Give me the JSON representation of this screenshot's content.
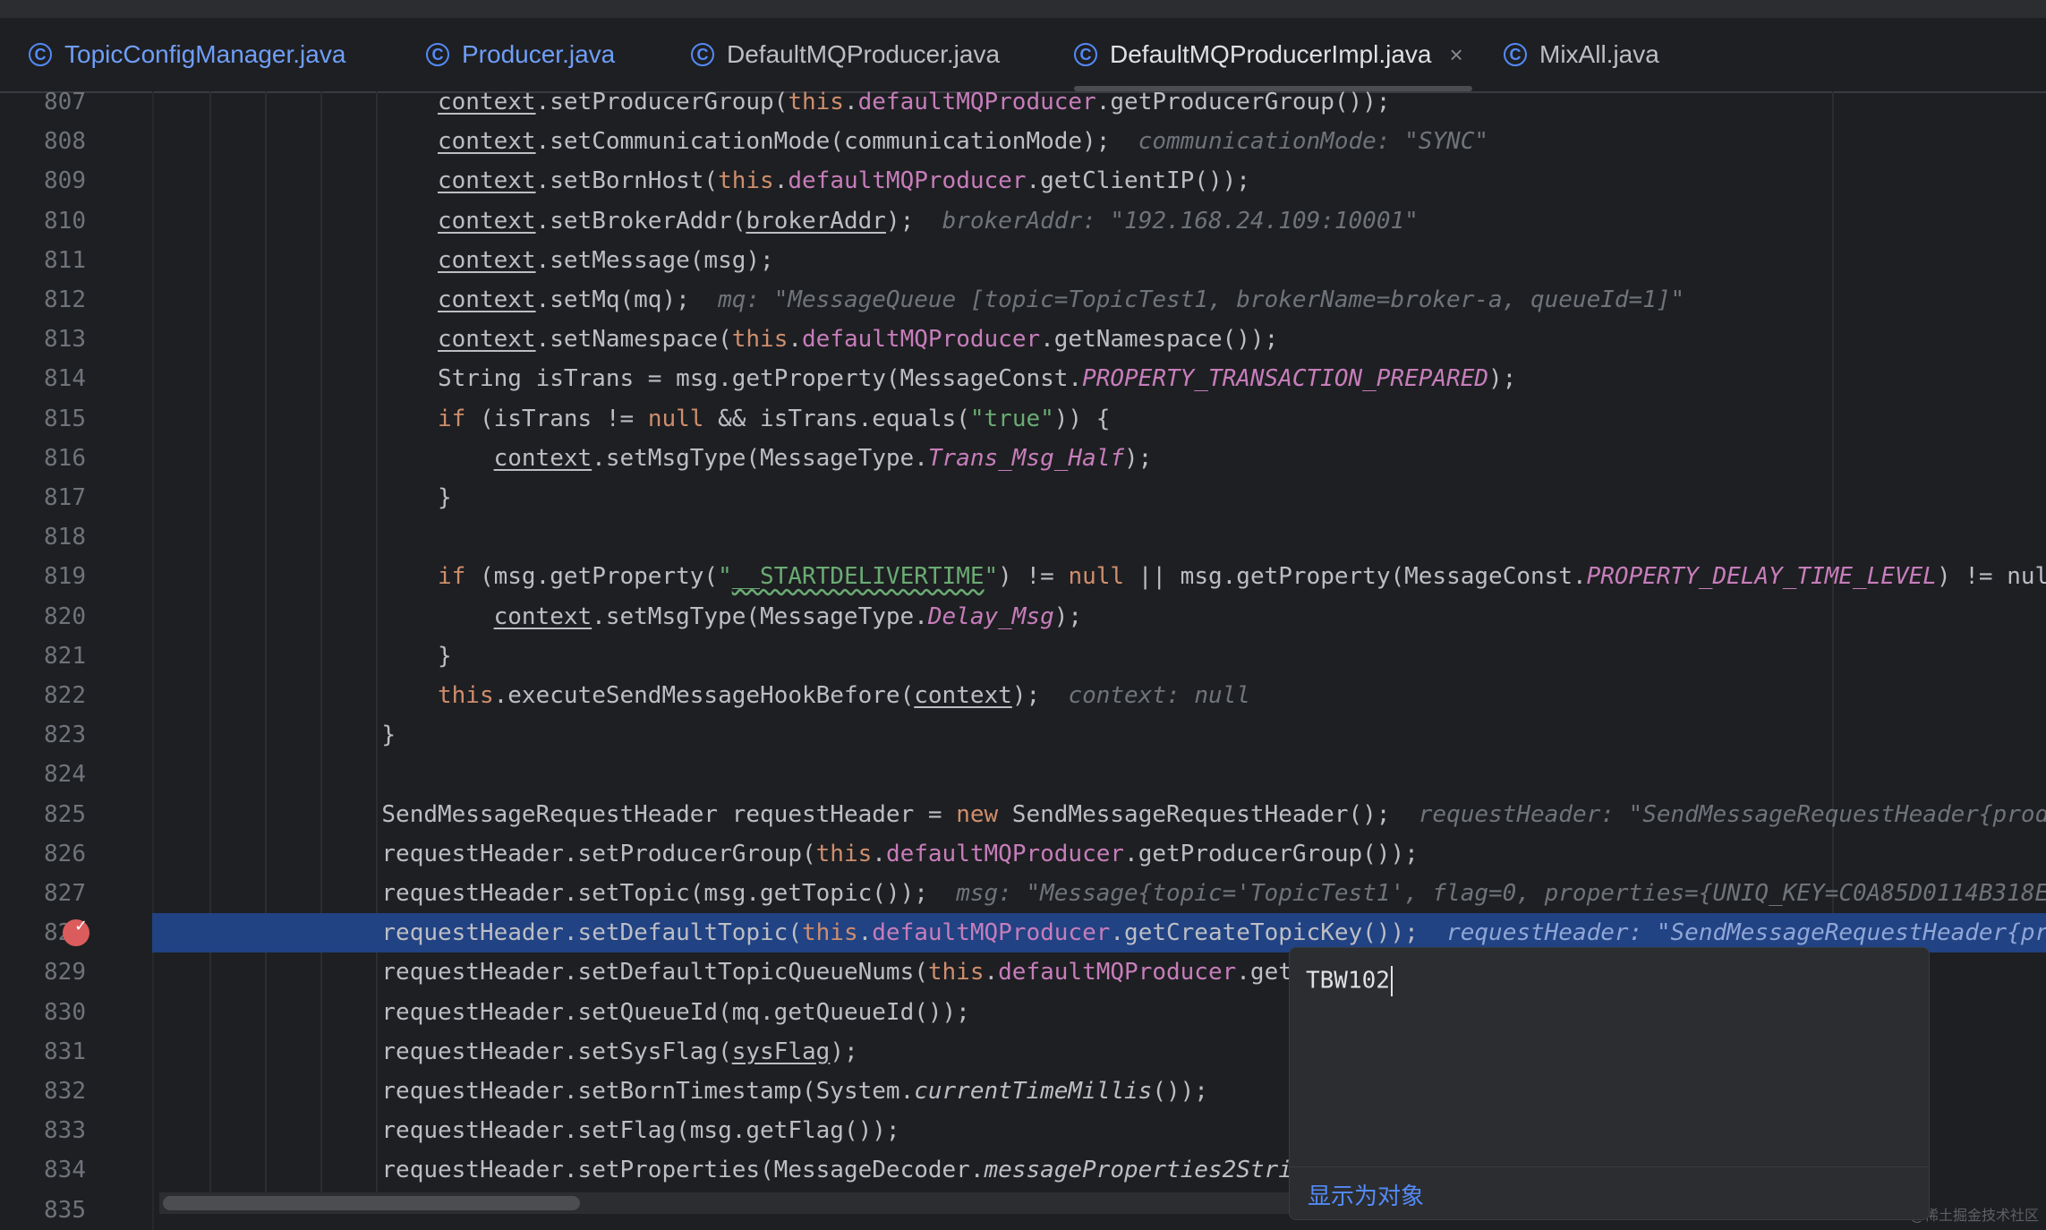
{
  "tabs": [
    {
      "label": "TopicConfigManager.java",
      "icon": "class-icon"
    },
    {
      "label": "Producer.java",
      "icon": "class-icon"
    },
    {
      "label": "DefaultMQProducer.java",
      "icon": "class-icon"
    },
    {
      "label": "DefaultMQProducerImpl.java",
      "icon": "class-icon",
      "active": true,
      "close": "×"
    },
    {
      "label": "MixAll.java",
      "icon": "class-icon"
    }
  ],
  "colors": {
    "background": "#1e1f22",
    "keyword": "#cf8e6d",
    "field": "#c77dbb",
    "string": "#6aab73",
    "exec_line": "#214283",
    "breakpoint": "#db5c5c",
    "link": "#548af7"
  },
  "code": {
    "executing_line": "828",
    "breakpoint_line": "828",
    "lines": [
      {
        "n": "807",
        "t": "context.setProducerGroup(this.defaultMQProducer.getProducerGroup());"
      },
      {
        "n": "808",
        "t": "context.setCommunicationMode(communicationMode);",
        "hint": "communicationMode: \"SYNC\""
      },
      {
        "n": "809",
        "t": "context.setBornHost(this.defaultMQProducer.getClientIP());"
      },
      {
        "n": "810",
        "t": "context.setBrokerAddr(brokerAddr);",
        "hint": "brokerAddr: \"192.168.24.109:10001\""
      },
      {
        "n": "811",
        "t": "context.setMessage(msg);"
      },
      {
        "n": "812",
        "t": "context.setMq(mq);",
        "hint": "mq: \"MessageQueue [topic=TopicTest1, brokerName=broker-a, queueId=1]\""
      },
      {
        "n": "813",
        "t": "context.setNamespace(this.defaultMQProducer.getNamespace());"
      },
      {
        "n": "814",
        "t": "String isTrans = msg.getProperty(MessageConst.PROPERTY_TRANSACTION_PREPARED);"
      },
      {
        "n": "815",
        "t": "if (isTrans != null && isTrans.equals(\"true\")) {"
      },
      {
        "n": "816",
        "t": "context.setMsgType(MessageType.Trans_Msg_Half);"
      },
      {
        "n": "817",
        "t": "}"
      },
      {
        "n": "818",
        "t": ""
      },
      {
        "n": "819",
        "t": "if (msg.getProperty(\"__STARTDELIVERTIME\") != null || msg.getProperty(MessageConst.PROPERTY_DELAY_TIME_LEVEL) != nul"
      },
      {
        "n": "820",
        "t": "context.setMsgType(MessageType.Delay_Msg);"
      },
      {
        "n": "821",
        "t": "}"
      },
      {
        "n": "822",
        "t": "this.executeSendMessageHookBefore(context);",
        "hint": "context: null"
      },
      {
        "n": "823",
        "t": "}"
      },
      {
        "n": "824",
        "t": ""
      },
      {
        "n": "825",
        "t": "SendMessageRequestHeader requestHeader = new SendMessageRequestHeader();",
        "hint": "requestHeader: \"SendMessageRequestHeader{prod"
      },
      {
        "n": "826",
        "t": "requestHeader.setProducerGroup(this.defaultMQProducer.getProducerGroup());"
      },
      {
        "n": "827",
        "t": "requestHeader.setTopic(msg.getTopic());",
        "hint": "msg: \"Message{topic='TopicTest1', flag=0, properties={UNIQ_KEY=C0A85D0114B318E"
      },
      {
        "n": "828",
        "t": "requestHeader.setDefaultTopic(this.defaultMQProducer.getCreateTopicKey());",
        "hint": "requestHeader: \"SendMessageRequestHeader{pr"
      },
      {
        "n": "829",
        "t": "requestHeader.setDefaultTopicQueueNums(this.defaultMQProducer.get"
      },
      {
        "n": "830",
        "t": "requestHeader.setQueueId(mq.getQueueId());"
      },
      {
        "n": "831",
        "t": "requestHeader.setSysFlag(sysFlag);"
      },
      {
        "n": "832",
        "t": "requestHeader.setBornTimestamp(System.currentTimeMillis());"
      },
      {
        "n": "833",
        "t": "requestHeader.setFlag(msg.getFlag());"
      },
      {
        "n": "834",
        "t": "requestHeader.setProperties(MessageDecoder.messageProperties2Stri"
      },
      {
        "n": "835",
        "t": ""
      }
    ]
  },
  "popup": {
    "value": "TBW102",
    "link": "显示为对象"
  },
  "watermark": "@稀土掘金技术社区"
}
